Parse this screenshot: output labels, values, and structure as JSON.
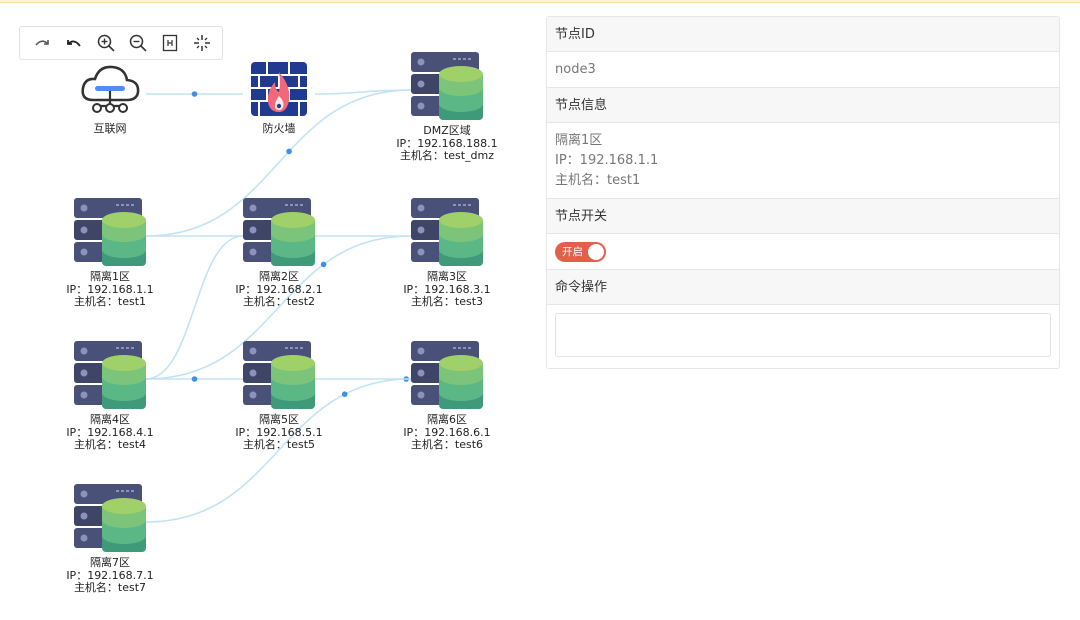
{
  "toolbar": {
    "tools": [
      {
        "name": "redo-icon"
      },
      {
        "name": "undo-icon"
      },
      {
        "name": "zoom-in-icon"
      },
      {
        "name": "zoom-out-icon"
      },
      {
        "name": "fit-view-icon"
      },
      {
        "name": "actual-size-icon"
      }
    ]
  },
  "nodes": [
    {
      "id": "internet",
      "icon": "cloud-network-icon",
      "lines": [
        "互联网"
      ]
    },
    {
      "id": "firewall",
      "icon": "firewall-icon",
      "lines": [
        "防火墙"
      ]
    },
    {
      "id": "dmz",
      "icon": "server-database-icon",
      "lines": [
        "DMZ区域",
        "IP：192.168.188.1",
        "主机名：test_dmz"
      ]
    },
    {
      "id": "node1",
      "icon": "server-database-icon",
      "lines": [
        "隔离1区",
        "IP：192.168.1.1",
        "主机名：test1"
      ]
    },
    {
      "id": "node2",
      "icon": "server-database-icon",
      "lines": [
        "隔离2区",
        "IP：192.168.2.1",
        "主机名：test2"
      ]
    },
    {
      "id": "node3",
      "icon": "server-database-icon",
      "lines": [
        "隔离3区",
        "IP：192.168.3.1",
        "主机名：test3"
      ]
    },
    {
      "id": "node4",
      "icon": "server-database-icon",
      "lines": [
        "隔离4区",
        "IP：192.168.4.1",
        "主机名：test4"
      ]
    },
    {
      "id": "node5",
      "icon": "server-database-icon",
      "lines": [
        "隔离5区",
        "IP：192.168.5.1",
        "主机名：test5"
      ]
    },
    {
      "id": "node6",
      "icon": "server-database-icon",
      "lines": [
        "隔离6区",
        "IP：192.168.6.1",
        "主机名：test6"
      ]
    },
    {
      "id": "node7",
      "icon": "server-database-icon",
      "lines": [
        "隔离7区",
        "IP：192.168.7.1",
        "主机名：test7"
      ]
    }
  ],
  "edges": [
    {
      "from": "internet",
      "to": "firewall"
    },
    {
      "from": "firewall",
      "to": "dmz"
    },
    {
      "from": "dmz",
      "to": "node1"
    },
    {
      "from": "node1",
      "to": "node2"
    },
    {
      "from": "node2",
      "to": "node3"
    },
    {
      "from": "node2",
      "to": "node4"
    },
    {
      "from": "node3",
      "to": "node4"
    },
    {
      "from": "node4",
      "to": "node5"
    },
    {
      "from": "node5",
      "to": "node6"
    },
    {
      "from": "node6",
      "to": "node7"
    }
  ],
  "panel": {
    "id_header": "节点ID",
    "id_value": "node3",
    "info_header": "节点信息",
    "info_lines": [
      "隔离1区",
      "IP：192.168.1.1",
      "主机名：test1"
    ],
    "switch_header": "节点开关",
    "switch_label": "开启",
    "switch_on": true,
    "command_header": "命令操作",
    "command_value": ""
  },
  "colors": {
    "edge": "#c3e3f4",
    "edge_dot": "#3f8fe4",
    "switch_on": "#e35f4a",
    "server_body": "#4a5178",
    "db_top": "#9fd06a",
    "db_mid": "#5bb886",
    "db_bottom": "#3e9a78",
    "firewall": "#1f3a8f",
    "flame": "#f2687a"
  }
}
